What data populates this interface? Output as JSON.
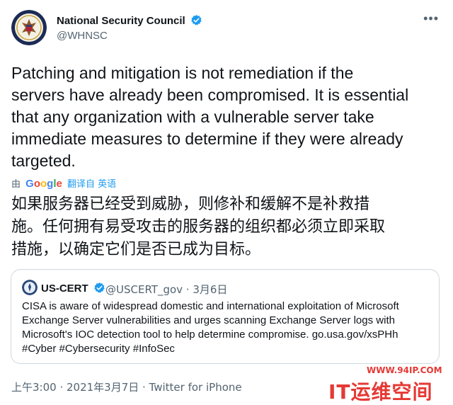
{
  "tweet": {
    "author": {
      "name": "National Security Council",
      "handle": "@WHNSC",
      "verified": true,
      "avatar_icon": "presidential-seal-icon"
    },
    "more_icon": "more-options-icon",
    "text_lines": [
      "Patching and mitigation is not remediation if the",
      "servers have already been compromised. It is essential",
      "that any organization with a vulnerable server take",
      "immediate measures to determine if they were already",
      "targeted."
    ],
    "translation": {
      "by_prefix": "由",
      "provider": "Google",
      "suffix": "翻译自 英语",
      "lines": [
        "如果服务器已经受到威胁，则修补和缓解不是补救措",
        "施。任何拥有易受攻击的服务器的组织都必须立即采取",
        "措施，以确定它们是否已成为目标。"
      ]
    },
    "quote": {
      "name": "US-CERT",
      "verified": true,
      "meta": "@USCERT_gov · 3月6日",
      "text_lines": [
        "CISA is aware of widespread domestic and international exploitation of Microsoft",
        "Exchange Server vulnerabilities and urges scanning Exchange Server logs with",
        "Microsoft's IOC detection tool to help determine compromise. go.usa.gov/xsPHh",
        "#Cyber #Cybersecurity #InfoSec"
      ]
    },
    "footer": "上午3:00 · 2021年3月7日 · Twitter for iPhone"
  },
  "watermark": {
    "url": "WWW.94IP.COM",
    "brand": "IT运维空间"
  },
  "colors": {
    "text": "#0f1419",
    "secondary": "#536471",
    "verified_blue": "#1d9bf0",
    "watermark_red": "#e53935"
  }
}
